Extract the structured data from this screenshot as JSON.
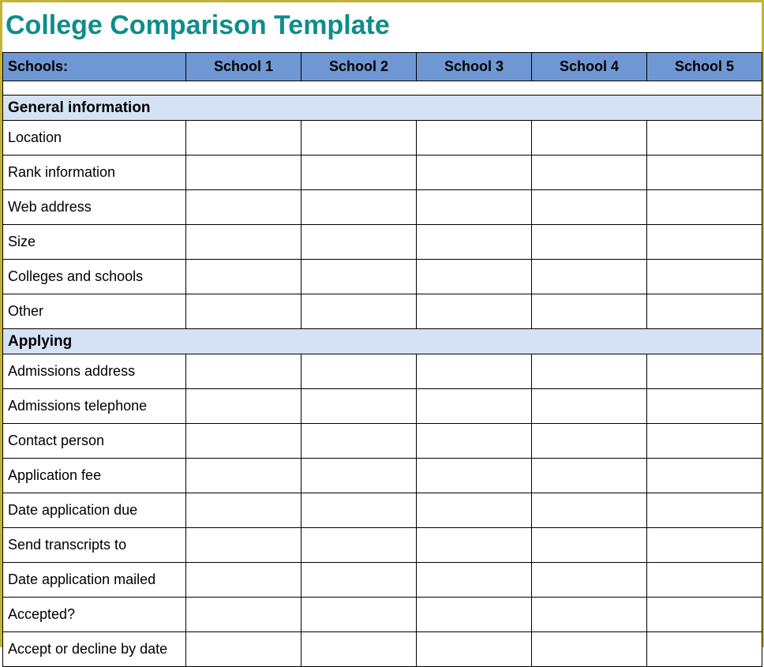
{
  "title": "College Comparison Template",
  "header": {
    "rowLabel": "Schools:",
    "columns": [
      "School 1",
      "School 2",
      "School 3",
      "School 4",
      "School 5"
    ]
  },
  "sections": [
    {
      "name": "General information",
      "rows": [
        {
          "label": "Location",
          "cells": [
            "",
            "",
            "",
            "",
            ""
          ]
        },
        {
          "label": "Rank information",
          "cells": [
            "",
            "",
            "",
            "",
            ""
          ]
        },
        {
          "label": "Web address",
          "cells": [
            "",
            "",
            "",
            "",
            ""
          ]
        },
        {
          "label": "Size",
          "cells": [
            "",
            "",
            "",
            "",
            ""
          ]
        },
        {
          "label": "Colleges and schools",
          "cells": [
            "",
            "",
            "",
            "",
            ""
          ]
        },
        {
          "label": "Other",
          "cells": [
            "",
            "",
            "",
            "",
            ""
          ]
        }
      ]
    },
    {
      "name": "Applying",
      "rows": [
        {
          "label": "Admissions address",
          "cells": [
            "",
            "",
            "",
            "",
            ""
          ]
        },
        {
          "label": "Admissions telephone",
          "cells": [
            "",
            "",
            "",
            "",
            ""
          ]
        },
        {
          "label": "Contact person",
          "cells": [
            "",
            "",
            "",
            "",
            ""
          ]
        },
        {
          "label": "Application fee",
          "cells": [
            "",
            "",
            "",
            "",
            ""
          ]
        },
        {
          "label": "Date application due",
          "cells": [
            "",
            "",
            "",
            "",
            ""
          ]
        },
        {
          "label": "Send transcripts to",
          "cells": [
            "",
            "",
            "",
            "",
            ""
          ]
        },
        {
          "label": "Date application mailed",
          "cells": [
            "",
            "",
            "",
            "",
            ""
          ]
        },
        {
          "label": "Accepted?",
          "cells": [
            "",
            "",
            "",
            "",
            ""
          ]
        },
        {
          "label": "Accept or decline by date",
          "cells": [
            "",
            "",
            "",
            "",
            ""
          ]
        }
      ]
    }
  ]
}
